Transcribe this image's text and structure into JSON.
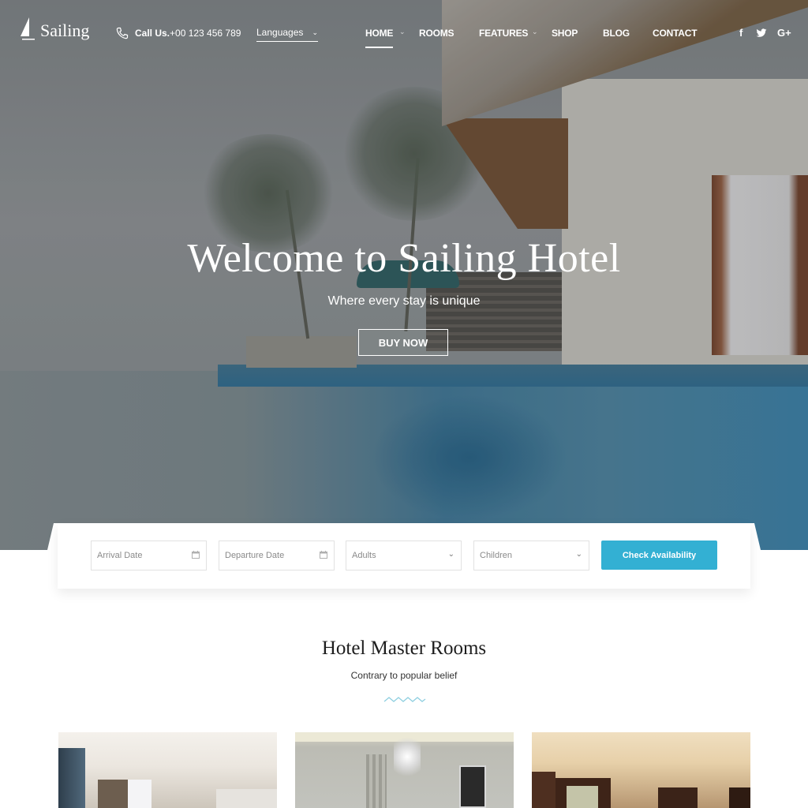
{
  "header": {
    "logo_text": "Sailing",
    "call_label": "Call Us.",
    "call_number": "+00 123 456 789",
    "language_select": "Languages",
    "nav": [
      {
        "label": "HOME",
        "active": true,
        "has_dropdown": true
      },
      {
        "label": "ROOMS",
        "active": false,
        "has_dropdown": false
      },
      {
        "label": "FEATURES",
        "active": false,
        "has_dropdown": true
      },
      {
        "label": "SHOP",
        "active": false,
        "has_dropdown": false
      },
      {
        "label": "BLOG",
        "active": false,
        "has_dropdown": false
      },
      {
        "label": "CONTACT",
        "active": false,
        "has_dropdown": false
      }
    ],
    "social": [
      {
        "icon": "facebook-icon",
        "glyph": "f"
      },
      {
        "icon": "twitter-icon",
        "glyph": "🐦"
      },
      {
        "icon": "google-plus-icon",
        "glyph": "G+"
      }
    ]
  },
  "hero": {
    "title": "Welcome to Sailing Hotel",
    "subtitle": "Where every stay is unique",
    "cta_label": "BUY NOW"
  },
  "booking": {
    "arrival_placeholder": "Arrival Date",
    "departure_placeholder": "Departure Date",
    "adults_select": "Adults",
    "children_select": "Children",
    "submit_label": "Check Availability",
    "accent_color": "#33b0d3"
  },
  "rooms_section": {
    "title": "Hotel Master Rooms",
    "subtitle": "Contrary to popular belief",
    "divider_color": "#8fcfe0"
  }
}
